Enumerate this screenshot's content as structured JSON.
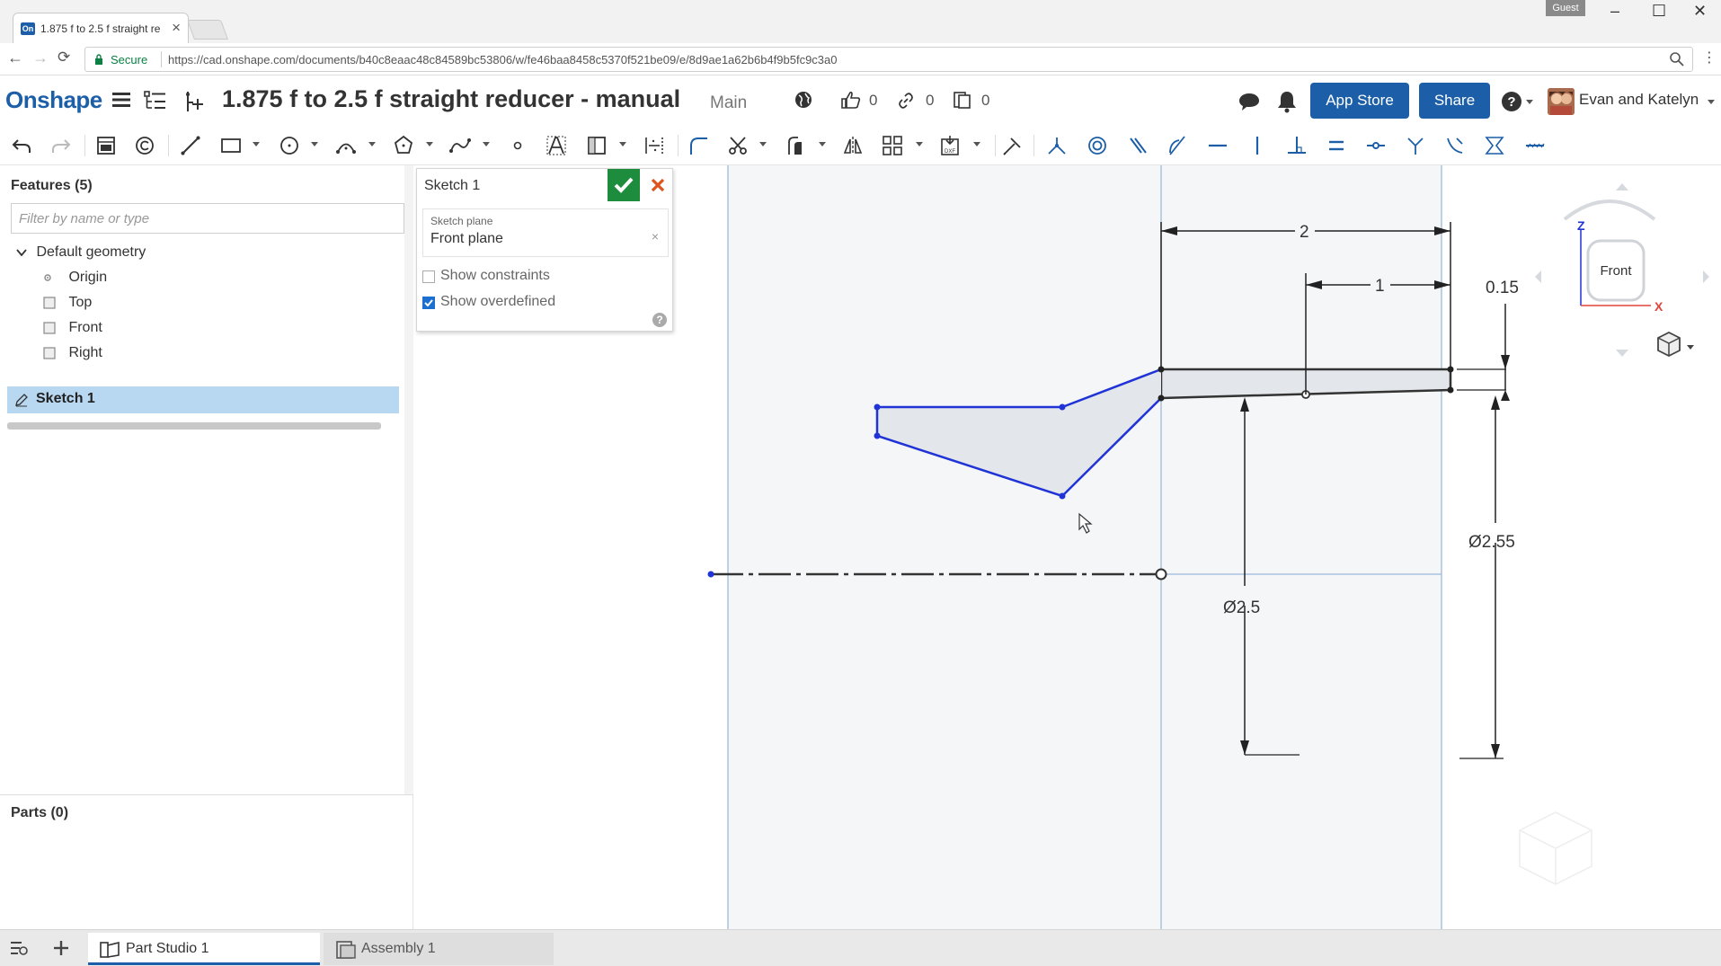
{
  "browser": {
    "tab_title": "1.875 f to 2.5 f straight re",
    "tab_favicon": "On",
    "guest_label": "Guest",
    "secure_label": "Secure",
    "url": "https://cad.onshape.com/documents/b40c8eaac48c84589bc53806/w/fe46baa8458c5370f521be09/e/8d9ae1a62b6b4f9b5fc9c3a0"
  },
  "header": {
    "logo": "Onshape",
    "doc_title": "1.875 f to 2.5 f straight reducer - manual",
    "branch": "Main",
    "likes": "0",
    "links": "0",
    "copies": "0",
    "app_store": "App Store",
    "share": "Share",
    "user": "Evan and Katelyn"
  },
  "features": {
    "header": "Features (5)",
    "filter_placeholder": "Filter by name or type",
    "default_geometry": "Default geometry",
    "items": [
      "Origin",
      "Top",
      "Front",
      "Right"
    ],
    "sketch": "Sketch 1",
    "parts_header": "Parts (0)"
  },
  "sketch_dialog": {
    "title": "Sketch 1",
    "plane_label": "Sketch plane",
    "plane_value": "Front plane",
    "show_constraints": "Show constraints",
    "show_overdefined": "Show overdefined",
    "show_constraints_checked": false,
    "show_overdefined_checked": true
  },
  "canvas": {
    "dim_2": "2",
    "dim_1": "1",
    "dim_015": "0.15",
    "dim_d255": "Ø2.55",
    "dim_d25": "Ø2.5",
    "view_cube_label": "Front",
    "axis_z": "Z",
    "axis_x": "X"
  },
  "bottom_tabs": [
    "Part Studio 1",
    "Assembly 1"
  ],
  "colors": {
    "brand": "#1c5fa8",
    "sketch_line": "#1f33d6",
    "selection": "#b8d8f2",
    "ok_green": "#1d8c3c",
    "cancel_orange": "#e0531c"
  }
}
